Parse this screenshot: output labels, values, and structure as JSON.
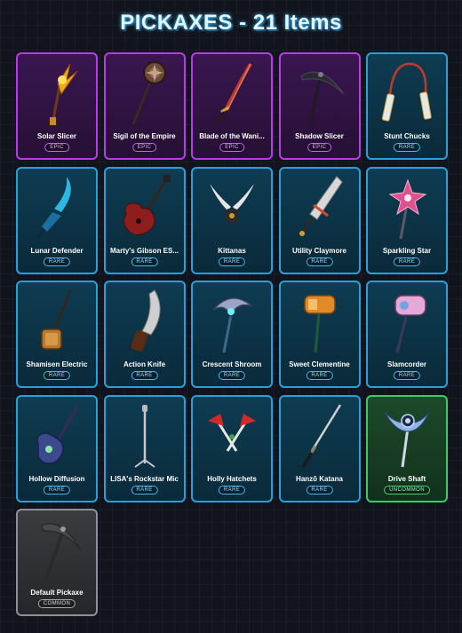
{
  "page": {
    "title": "PICKAXES - 21 Items"
  },
  "colors": {
    "epic": "#b73ce6",
    "rare": "#2b9fd8",
    "uncommon": "#3bcc67",
    "common": "#8d9096",
    "background": "#12141d"
  },
  "items": [
    {
      "name": "Solar Slicer",
      "rarity": "EPIC",
      "icon": "solar-slicer-icon"
    },
    {
      "name": "Sigil of the Empire",
      "rarity": "EPIC",
      "icon": "sigil-of-the-empire-icon"
    },
    {
      "name": "Blade of the Wani...",
      "rarity": "EPIC",
      "icon": "blade-of-the-wani-icon"
    },
    {
      "name": "Shadow Slicer",
      "rarity": "EPIC",
      "icon": "shadow-slicer-icon"
    },
    {
      "name": "Stunt Chucks",
      "rarity": "RARE",
      "icon": "stunt-chucks-icon"
    },
    {
      "name": "Lunar Defender",
      "rarity": "RARE",
      "icon": "lunar-defender-icon"
    },
    {
      "name": "Marty's Gibson ES...",
      "rarity": "RARE",
      "icon": "guitar-icon"
    },
    {
      "name": "Kittanas",
      "rarity": "RARE",
      "icon": "kittanas-icon"
    },
    {
      "name": "Utility Claymore",
      "rarity": "RARE",
      "icon": "utility-claymore-icon"
    },
    {
      "name": "Sparkling Star",
      "rarity": "RARE",
      "icon": "sparkling-star-icon"
    },
    {
      "name": "Shamisen Electric",
      "rarity": "RARE",
      "icon": "shamisen-icon"
    },
    {
      "name": "Action Knife",
      "rarity": "RARE",
      "icon": "action-knife-icon"
    },
    {
      "name": "Crescent Shroom",
      "rarity": "RARE",
      "icon": "crescent-shroom-icon"
    },
    {
      "name": "Sweet Clementine",
      "rarity": "RARE",
      "icon": "sweet-clementine-icon"
    },
    {
      "name": "Slamcorder",
      "rarity": "RARE",
      "icon": "slamcorder-icon"
    },
    {
      "name": "Hollow Diffusion",
      "rarity": "RARE",
      "icon": "hollow-diffusion-guitar-icon"
    },
    {
      "name": "LISA's Rockstar Mic",
      "rarity": "RARE",
      "icon": "mic-stand-icon"
    },
    {
      "name": "Holly Hatchets",
      "rarity": "RARE",
      "icon": "holly-hatchets-icon"
    },
    {
      "name": "Hanzō Katana",
      "rarity": "RARE",
      "icon": "katana-icon"
    },
    {
      "name": "Drive Shaft",
      "rarity": "UNCOMMON",
      "icon": "drive-shaft-icon"
    },
    {
      "name": "Default Pickaxe",
      "rarity": "COMMON",
      "icon": "default-pickaxe-icon"
    }
  ]
}
